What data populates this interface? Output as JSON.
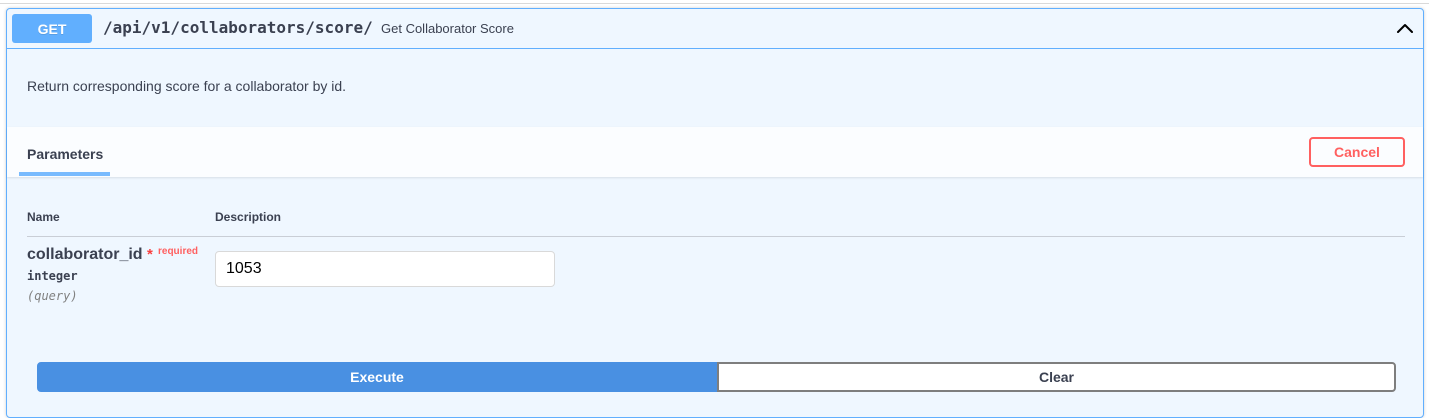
{
  "operation": {
    "method": "GET",
    "path": "/api/v1/collaborators/score/",
    "summary": "Get Collaborator Score",
    "expand_icon": "chevron-up-icon",
    "description": "Return corresponding score for a collaborator by id."
  },
  "parameters": {
    "title": "Parameters",
    "cancel_label": "Cancel",
    "columns": {
      "name": "Name",
      "description": "Description"
    },
    "items": [
      {
        "name": "collaborator_id",
        "required_star": "*",
        "required_label": "required",
        "type": "integer",
        "in": "(query)",
        "value": "1053"
      }
    ]
  },
  "actions": {
    "execute_label": "Execute",
    "clear_label": "Clear"
  },
  "colors": {
    "get_accent": "#61affe",
    "execute": "#4990e2",
    "cancel": "#ff6060",
    "required": "#f93e3e"
  }
}
